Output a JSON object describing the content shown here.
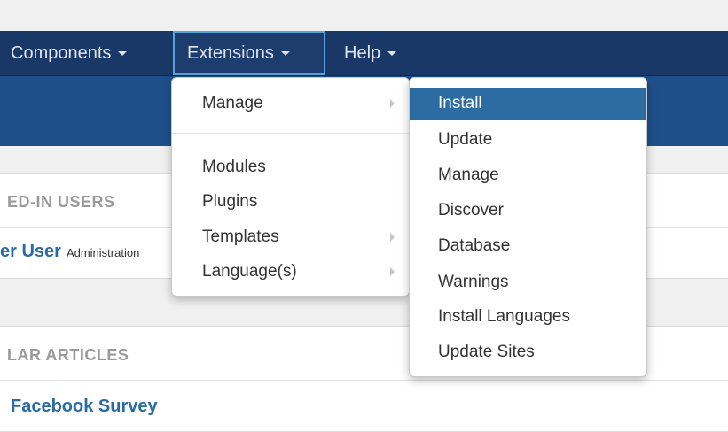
{
  "navbar": {
    "items": [
      {
        "label": "Components"
      },
      {
        "label": "Extensions"
      },
      {
        "label": "Help"
      }
    ]
  },
  "panels": {
    "logged_in": {
      "heading": "ED-IN USERS",
      "user_link": "er User",
      "user_role": "Administration"
    },
    "popular": {
      "heading": "LAR ARTICLES",
      "article_link": "Facebook Survey"
    }
  },
  "extensions_menu": {
    "items": [
      {
        "label": "Manage"
      },
      {
        "label": "Modules"
      },
      {
        "label": "Plugins"
      },
      {
        "label": "Templates"
      },
      {
        "label": "Language(s)"
      }
    ]
  },
  "manage_submenu": {
    "items": [
      {
        "label": "Install"
      },
      {
        "label": "Update"
      },
      {
        "label": "Manage"
      },
      {
        "label": "Discover"
      },
      {
        "label": "Database"
      },
      {
        "label": "Warnings"
      },
      {
        "label": "Install Languages"
      },
      {
        "label": "Update Sites"
      }
    ]
  }
}
